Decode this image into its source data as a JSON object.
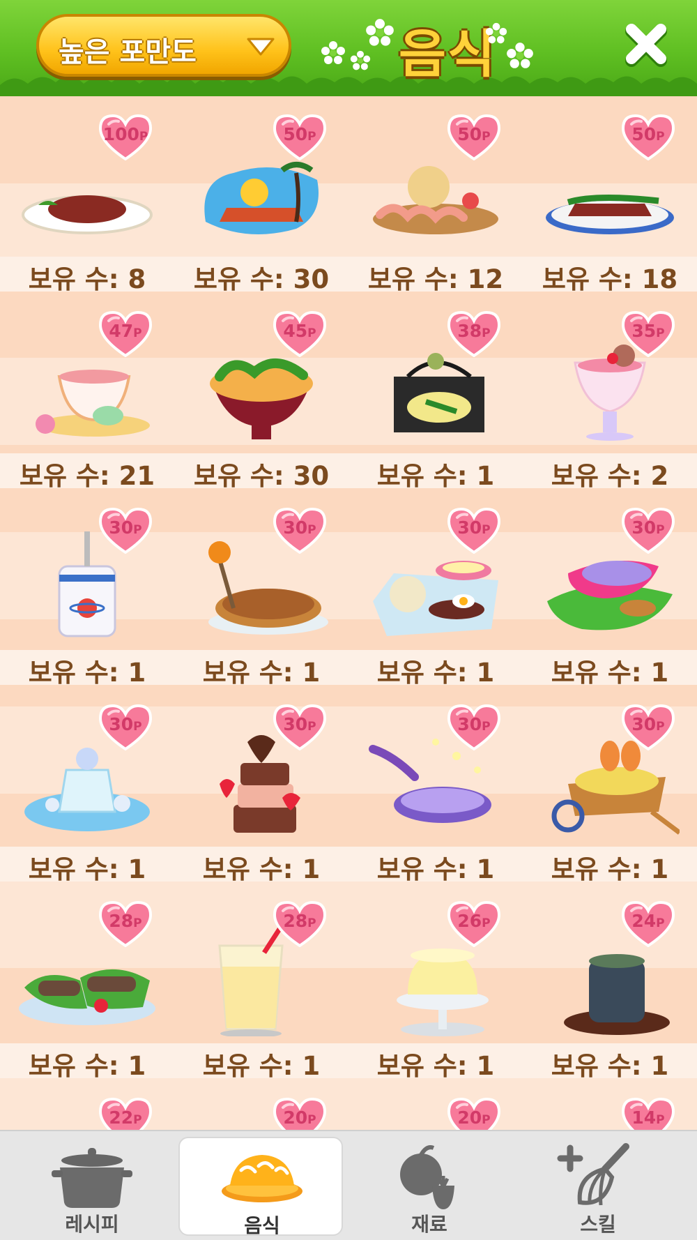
{
  "header": {
    "filter_label": "높은 포만도",
    "title": "음식",
    "colors": {
      "grass": "#5fbf22",
      "dropdown": "#ffc21a",
      "title": "#ffd23a"
    }
  },
  "items": [
    {
      "points": "100",
      "count": "보유 수: 8",
      "icon": "steak-plate-icon"
    },
    {
      "points": "50",
      "count": "보유 수: 30",
      "icon": "tropical-beach-dish-icon"
    },
    {
      "points": "50",
      "count": "보유 수: 12",
      "icon": "seafood-platter-icon"
    },
    {
      "points": "50",
      "count": "보유 수: 18",
      "icon": "steak-blue-plate-icon"
    },
    {
      "points": "47",
      "count": "보유 수: 21",
      "icon": "tea-cup-macaron-icon"
    },
    {
      "points": "45",
      "count": "보유 수: 30",
      "icon": "salad-bowl-icon"
    },
    {
      "points": "38",
      "count": "보유 수: 1",
      "icon": "rice-tray-icon"
    },
    {
      "points": "35",
      "count": "보유 수: 2",
      "icon": "parfait-glass-icon"
    },
    {
      "points": "30",
      "count": "보유 수: 1",
      "icon": "planet-cup-icon"
    },
    {
      "points": "30",
      "count": "보유 수: 1",
      "icon": "pumpkin-pie-icon"
    },
    {
      "points": "30",
      "count": "보유 수: 1",
      "icon": "breakfast-set-icon"
    },
    {
      "points": "30",
      "count": "보유 수: 1",
      "icon": "leaf-dish-icon"
    },
    {
      "points": "30",
      "count": "보유 수: 1",
      "icon": "ice-dessert-icon"
    },
    {
      "points": "30",
      "count": "보유 수: 1",
      "icon": "heart-cake-icon"
    },
    {
      "points": "30",
      "count": "보유 수: 1",
      "icon": "starry-soup-icon"
    },
    {
      "points": "30",
      "count": "보유 수: 1",
      "icon": "rabbit-cart-icon"
    },
    {
      "points": "28",
      "count": "보유 수: 1",
      "icon": "green-roll-icon"
    },
    {
      "points": "28",
      "count": "보유 수: 1",
      "icon": "apple-juice-icon"
    },
    {
      "points": "26",
      "count": "보유 수: 1",
      "icon": "pudding-icon"
    },
    {
      "points": "24",
      "count": "보유 수: 1",
      "icon": "tea-cup-icon"
    },
    {
      "points": "22",
      "count": "",
      "icon": "partial-item-icon"
    },
    {
      "points": "20",
      "count": "",
      "icon": "partial-item-icon"
    },
    {
      "points": "20",
      "count": "",
      "icon": "berry-item-icon"
    },
    {
      "points": "14",
      "count": "",
      "icon": "partial-item-icon"
    }
  ],
  "point_unit": "P",
  "nav": {
    "tabs": [
      {
        "label": "레시피",
        "icon": "pot-icon",
        "active": false
      },
      {
        "label": "음식",
        "icon": "omelet-dish-icon",
        "active": true
      },
      {
        "label": "재료",
        "icon": "ingredients-icon",
        "active": false
      },
      {
        "label": "스킬",
        "icon": "whisk-skill-icon",
        "active": false
      }
    ]
  }
}
